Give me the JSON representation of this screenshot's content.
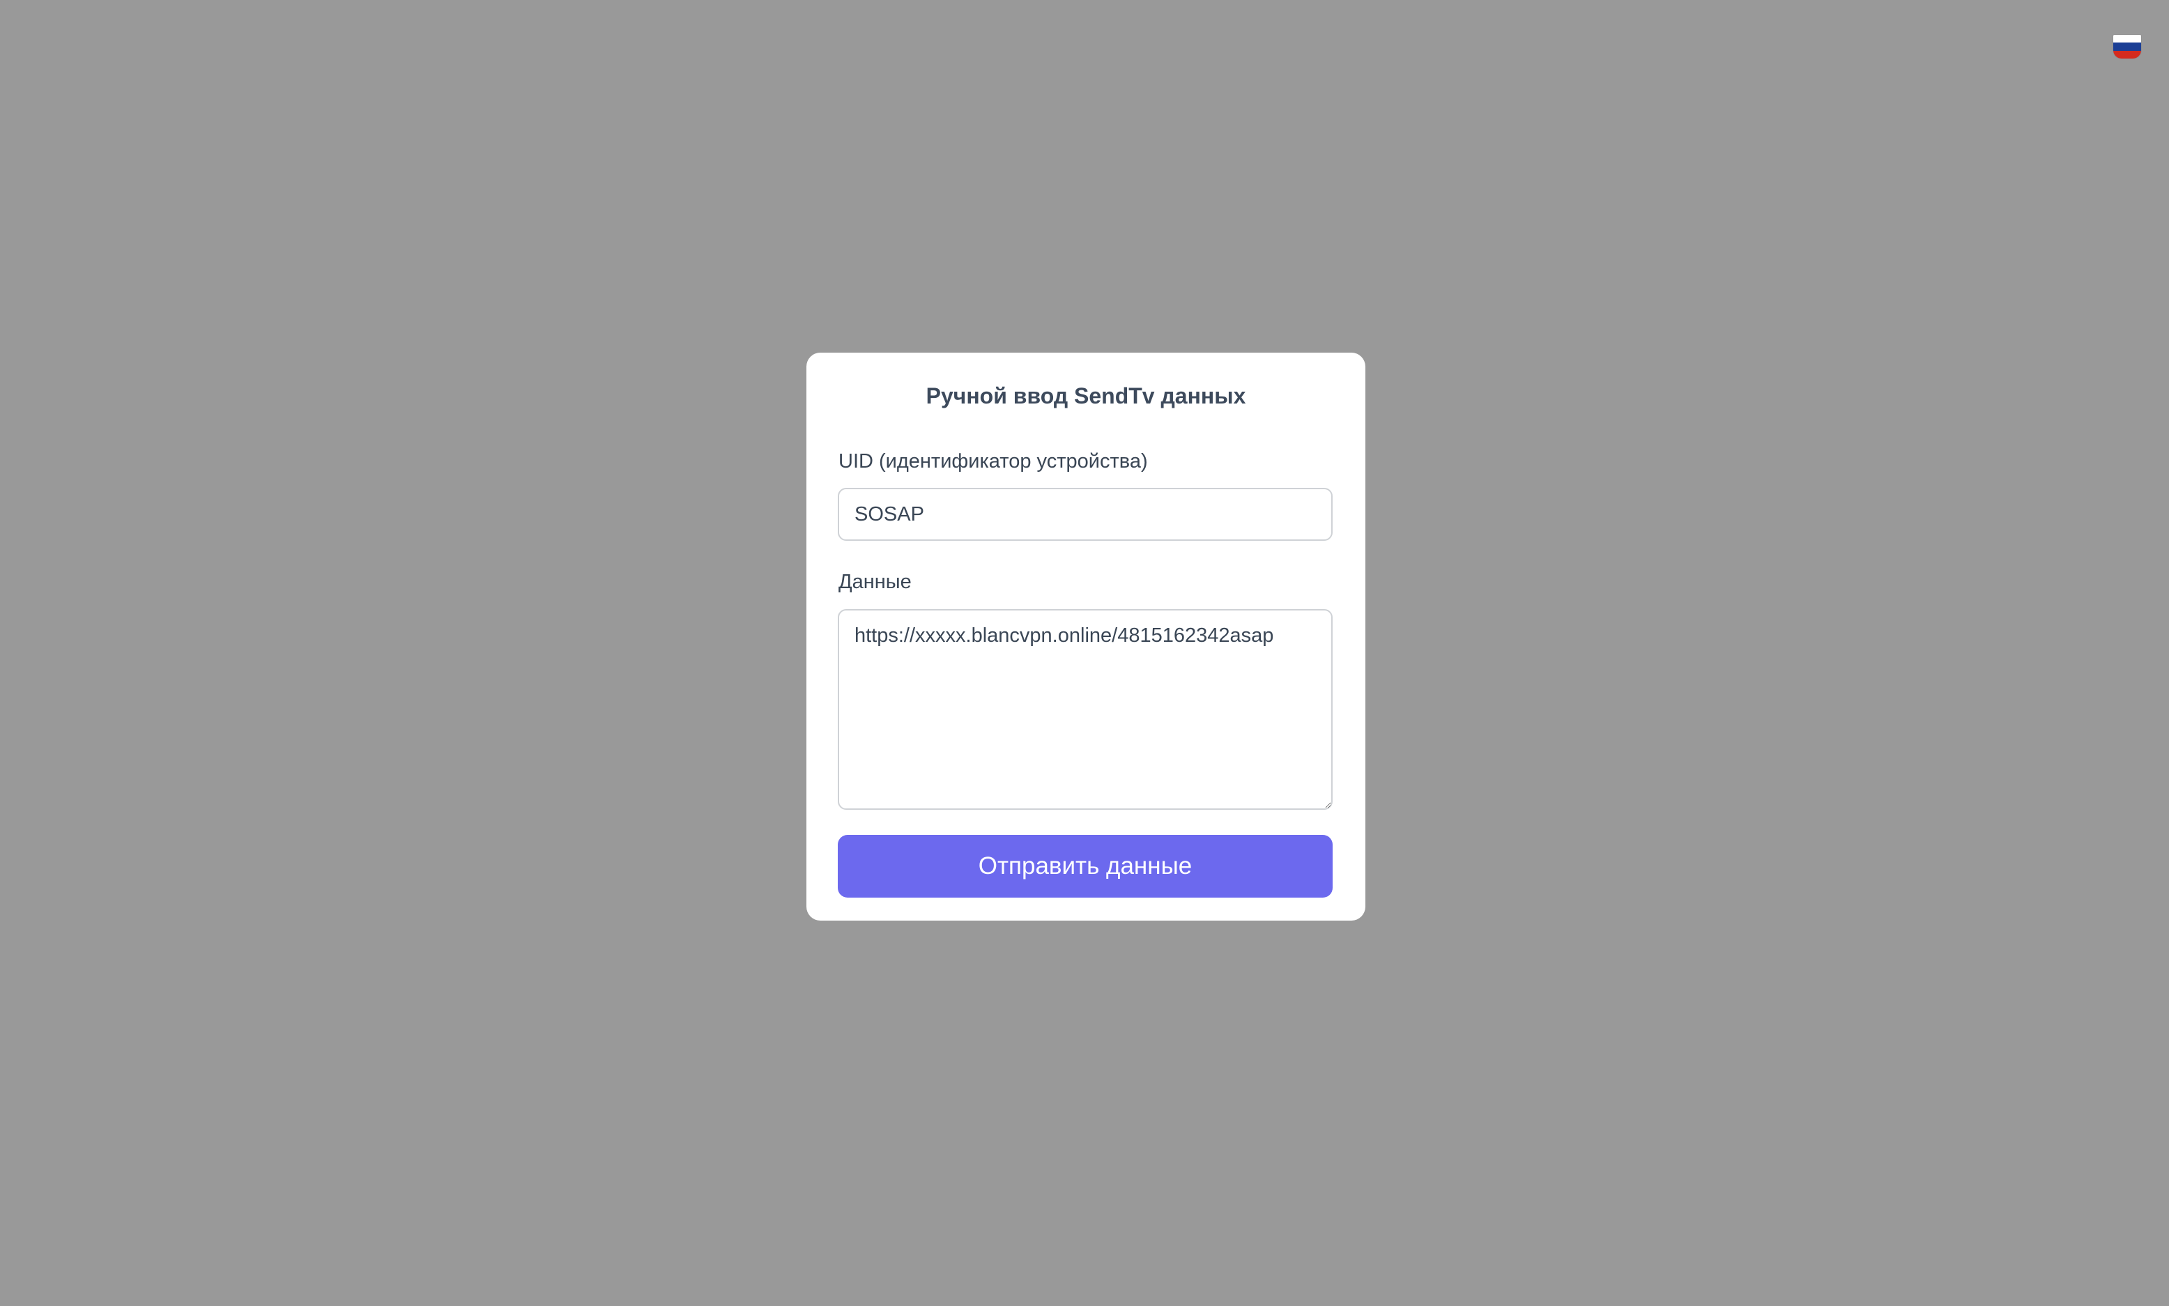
{
  "language": {
    "flag_name": "russia-flag-icon",
    "colors": [
      "#ffffff",
      "#1c3f95",
      "#d52b1e"
    ]
  },
  "modal": {
    "title": "Ручной ввод SendTv данных",
    "uid_label": "UID (идентификатор устройства)",
    "uid_value": "SOSAP",
    "data_label": "Данные",
    "data_value": "https://xxxxx.blancvpn.online/4815162342asap",
    "submit_label": "Отправить данные"
  },
  "colors": {
    "backdrop": "#999999",
    "accent": "#6c69ee",
    "text": "#3a4655"
  }
}
